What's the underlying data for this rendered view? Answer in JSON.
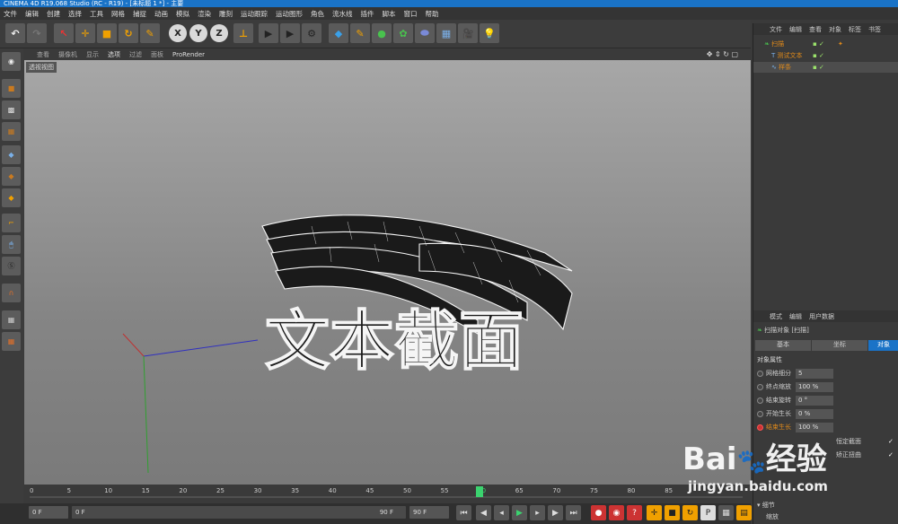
{
  "title": "CINEMA 4D R19.068 Studio (RC - R19) - [未标题 1 *] - 主要",
  "menu": [
    "文件",
    "编辑",
    "创建",
    "选择",
    "工具",
    "网格",
    "捕捉",
    "动画",
    "模拟",
    "渲染",
    "雕刻",
    "运动跟踪",
    "运动图形",
    "角色",
    "流水线",
    "插件",
    "脚本",
    "窗口",
    "帮助"
  ],
  "viewport_menu": [
    "查看",
    "摄像机",
    "显示",
    "选项",
    "过滤",
    "面板",
    "ProRender"
  ],
  "viewport_label": "透视视图",
  "toolbar_axes": [
    "X",
    "Y",
    "Z"
  ],
  "object_manager": {
    "tabs": [
      "文件",
      "编辑",
      "查看",
      "对象",
      "标签",
      "书签"
    ],
    "objects": [
      "扫描",
      "测试文本",
      "样条"
    ]
  },
  "attribute_manager": {
    "tabs": [
      "模式",
      "编辑",
      "用户数据"
    ],
    "header": "扫描对象 [扫描]",
    "sub_tabs": [
      "基本",
      "坐标",
      "对象"
    ],
    "section": "对象属性",
    "props": [
      {
        "label": "网格细分",
        "value": "5"
      },
      {
        "label": "终点缩放",
        "value": "100 %"
      },
      {
        "label": "结束旋转",
        "value": "0 °"
      },
      {
        "label": "开始生长",
        "value": "0 %"
      },
      {
        "label": "结束生长",
        "value": "100 %"
      }
    ],
    "checks": [
      "恒定截面",
      "矫正扭曲"
    ],
    "footer": "细节",
    "footer_item": "缩放"
  },
  "timeline": {
    "ticks": [
      "0",
      "5",
      "10",
      "15",
      "20",
      "25",
      "30",
      "35",
      "40",
      "45",
      "50",
      "55",
      "60",
      "65",
      "70",
      "75",
      "80",
      "85"
    ],
    "current_frame": "60",
    "start": "0 F",
    "field2": "0 F",
    "end": "90 F",
    "end2": "90 F"
  },
  "scene_text": "文本截面",
  "watermark": {
    "logo": "Bai",
    "paw": "du",
    "cn": "经验",
    "url": "jingyan.baidu.com"
  },
  "colors": {
    "accent": "#1a73c7",
    "highlight": "#e08a1a",
    "check": "#9be36b"
  }
}
